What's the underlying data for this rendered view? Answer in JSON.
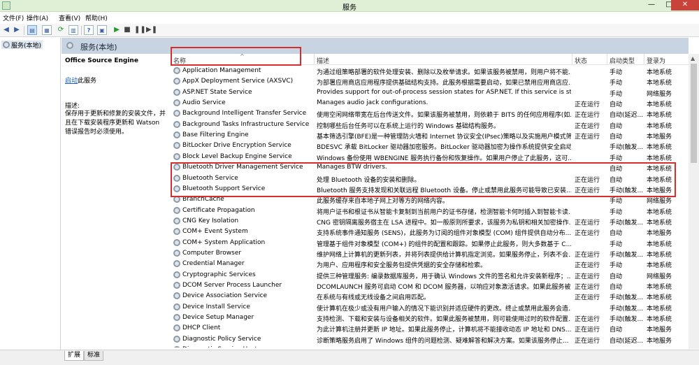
{
  "window": {
    "title": "服务",
    "min": "—",
    "max": "□",
    "close": "✕"
  },
  "menu": [
    "文件(F)",
    "操作(A)",
    "查看(V)",
    "帮助(H)"
  ],
  "tree": {
    "root": "服务(本地)"
  },
  "header": {
    "title": "服务(本地)"
  },
  "details": {
    "name": "Office Source Engine",
    "action_link": "启动",
    "action_suffix": "此服务",
    "desc_label": "描述:",
    "desc_text": "保存用于更新和修复的安装文件，并且在下载安装程序更新和 Watson 错误报告时必须使用。"
  },
  "columns": {
    "name": "名称",
    "desc": "描述",
    "status": "状态",
    "startup": "启动类型",
    "logon": "登录为"
  },
  "services": [
    {
      "name": "Application Management",
      "desc": "为通过组策略部署的软件处理安装、删除以及枚举请求。如果该服务被禁用，则用户将不能...",
      "status": "",
      "startup": "手动",
      "logon": "本地系统"
    },
    {
      "name": "AppX Deployment Service (AXSVC)",
      "desc": "为部署应用商店应用程序提供基础结构支持。此服务根据需要启动，如果已禁用应用商店应...",
      "status": "",
      "startup": "手动",
      "logon": "本地系统"
    },
    {
      "name": "ASP.NET State Service",
      "desc": "Provides support for out-of-process session states for ASP.NET. If this service is st...",
      "status": "",
      "startup": "手动",
      "logon": "网络服务"
    },
    {
      "name": "Audio Service",
      "desc": "Manages audio jack configurations.",
      "status": "正在运行",
      "startup": "自动",
      "logon": "本地系统"
    },
    {
      "name": "Background Intelligent Transfer Service",
      "desc": "使用空闲网络带宽在后台传送文件。如果该服务被禁用，则依赖于 BITS 的任何应用程序(如...",
      "status": "正在运行",
      "startup": "自动(延迟...",
      "logon": "本地系统"
    },
    {
      "name": "Background Tasks Infrastructure Service",
      "desc": "控制哪些后台任务可以在系统上运行的 Windows 基础结构服务。",
      "status": "正在运行",
      "startup": "自动",
      "logon": "本地系统"
    },
    {
      "name": "Base Filtering Engine",
      "desc": "基本筛选引擎(BFE)是一种管理防火墙和 Internet 协议安全(IPsec)策略以及实施用户模式筛...",
      "status": "正在运行",
      "startup": "自动",
      "logon": "本地服务"
    },
    {
      "name": "BitLocker Drive Encryption Service",
      "desc": "BDESVC 承载 BitLocker 驱动器加密服务。BitLocker 驱动器加密为操作系统提供安全启动...",
      "status": "",
      "startup": "手动(触发...",
      "logon": "本地系统"
    },
    {
      "name": "Block Level Backup Engine Service",
      "desc": "Windows 备份使用 WBENGINE 服务执行备份和恢复操作。如果用户停止了此服务，这可...",
      "status": "",
      "startup": "手动",
      "logon": "本地系统"
    },
    {
      "name": "Bluetooth Driver Management Service",
      "desc": "Manages BTW drivers.",
      "status": "",
      "startup": "自动",
      "logon": "本地系统"
    },
    {
      "name": "Bluetooth Service",
      "desc": "处理 Bluetooth 设备的安装和删除。",
      "status": "正在运行",
      "startup": "自动",
      "logon": "本地系统"
    },
    {
      "name": "Bluetooth Support Service",
      "desc": "Bluetooth 服务支持发现和关联远程 Bluetooth 设备。停止或禁用此服务可能导致已安装...",
      "status": "正在运行",
      "startup": "手动(触发...",
      "logon": "本地服务"
    },
    {
      "name": "BranchCache",
      "desc": "此服务缓存来自本地子网上对等方的网络内容。",
      "status": "",
      "startup": "手动",
      "logon": "网络服务"
    },
    {
      "name": "Certificate Propagation",
      "desc": "将用户证书和根证书从智能卡复制到当前用户的证书存储，检测智能卡何时插入到智能卡读...",
      "status": "",
      "startup": "手动",
      "logon": "本地系统"
    },
    {
      "name": "CNG Key Isolation",
      "desc": "CNG 密钥隔离服务宿主在 LSA 进程中。如一般原则所要求，该服务为私钥和相关加密操作...",
      "status": "正在运行",
      "startup": "手动(触发...",
      "logon": "本地系统"
    },
    {
      "name": "COM+ Event System",
      "desc": "支持系统事件通知服务 (SENS)，此服务为订阅的组件对象模型 (COM) 组件提供自动分布...",
      "status": "正在运行",
      "startup": "自动",
      "logon": "本地服务"
    },
    {
      "name": "COM+ System Application",
      "desc": "管理基于组件对象模型 (COM+) 的组件的配置和跟踪。如果停止此服务，则大多数基于 C...",
      "status": "",
      "startup": "手动",
      "logon": "本地系统"
    },
    {
      "name": "Computer Browser",
      "desc": "维护网络上计算机的更新列表，并将列表提供给计算机指定浏览。如果服务停止，列表不会...",
      "status": "正在运行",
      "startup": "手动(触发...",
      "logon": "本地系统"
    },
    {
      "name": "Credential Manager",
      "desc": "为用户、应用程序和安全服务包提供凭据的安全存储和检索。",
      "status": "正在运行",
      "startup": "手动",
      "logon": "本地系统"
    },
    {
      "name": "Cryptographic Services",
      "desc": "提供三种管理服务: 编录数据库服务，用于确认 Windows 文件的签名和允许安装新程序；...",
      "status": "正在运行",
      "startup": "自动",
      "logon": "网络服务"
    },
    {
      "name": "DCOM Server Process Launcher",
      "desc": "DCOMLAUNCH 服务可启动 COM 和 DCOM 服务器，以响应对象激活请求。如果此服务被...",
      "status": "正在运行",
      "startup": "自动",
      "logon": "本地系统"
    },
    {
      "name": "Device Association Service",
      "desc": "在系统与有线或无线设备之间启用匹配。",
      "status": "正在运行",
      "startup": "手动(触发...",
      "logon": "本地系统"
    },
    {
      "name": "Device Install Service",
      "desc": "使计算机在极少或没有用户输入的情况下能识别并适应硬件的更改。终止或禁用此服务会造...",
      "status": "",
      "startup": "手动(触发...",
      "logon": "本地系统"
    },
    {
      "name": "Device Setup Manager",
      "desc": "支持检测、下载和安装与设备相关的软件。如果此服务被禁用，则可能使用过时的软件配置...",
      "status": "正在运行",
      "startup": "手动(触发...",
      "logon": "本地系统"
    },
    {
      "name": "DHCP Client",
      "desc": "为此计算机注册并更新 IP 地址。如果此服务停止，计算机将不能接收动态 IP 地址和 DNS...",
      "status": "正在运行",
      "startup": "自动",
      "logon": "本地服务"
    },
    {
      "name": "Diagnostic Policy Service",
      "desc": "诊断策略服务启用了 Windows 组件的问题检测、疑难解答和解决方案。如果该服务停止...",
      "status": "正在运行",
      "startup": "自动(延迟...",
      "logon": "本地服务"
    },
    {
      "name": "Diagnostic Service Host",
      "desc": "诊断服务主机被诊断策略服务用来承载需要在本地服务上下文中运行的诊断...",
      "status": "",
      "startup": "手动",
      "logon": "本地服务"
    }
  ],
  "bottom_tabs": [
    "扩展",
    "标准"
  ]
}
